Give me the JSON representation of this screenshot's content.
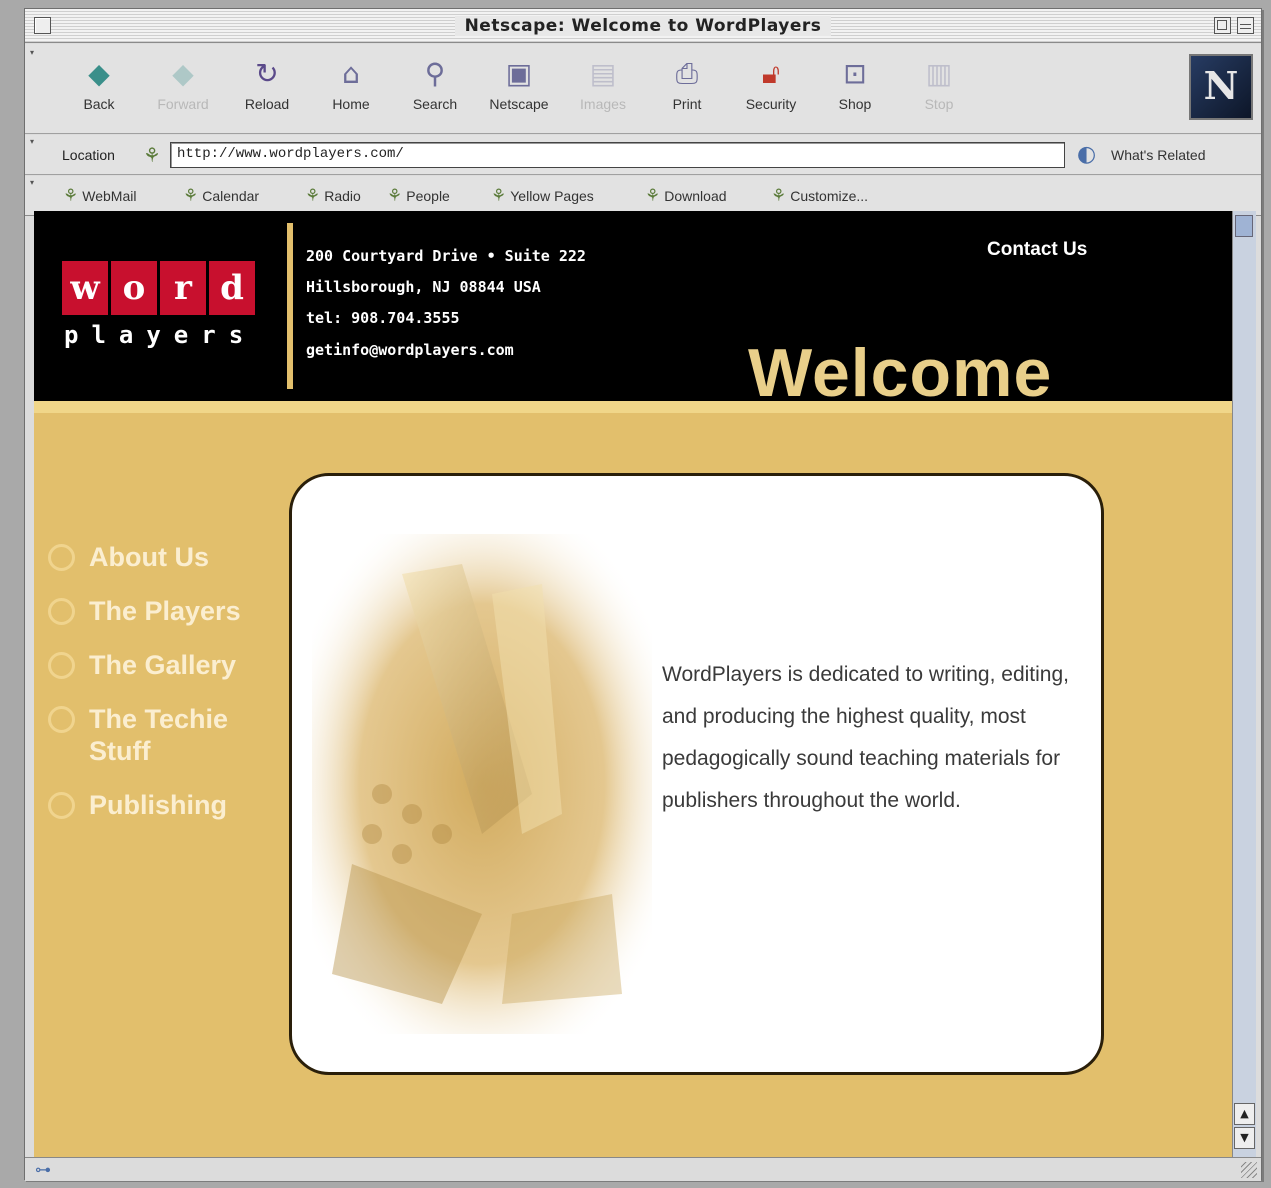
{
  "window": {
    "title": "Netscape: Welcome to WordPlayers"
  },
  "toolbar": {
    "buttons": [
      {
        "label": "Back",
        "icon": "back-arrow-icon"
      },
      {
        "label": "Forward",
        "icon": "forward-arrow-icon"
      },
      {
        "label": "Reload",
        "icon": "reload-icon"
      },
      {
        "label": "Home",
        "icon": "home-icon"
      },
      {
        "label": "Search",
        "icon": "search-icon"
      },
      {
        "label": "Netscape",
        "icon": "netscape-icon"
      },
      {
        "label": "Images",
        "icon": "images-icon"
      },
      {
        "label": "Print",
        "icon": "print-icon"
      },
      {
        "label": "Security",
        "icon": "lock-icon"
      },
      {
        "label": "Shop",
        "icon": "shop-icon"
      },
      {
        "label": "Stop",
        "icon": "stop-icon"
      }
    ],
    "brand_letter": "N"
  },
  "location_bar": {
    "label": "Location",
    "url": "http://www.wordplayers.com/",
    "related_label": "What's Related"
  },
  "personal_toolbar": {
    "items": [
      "WebMail",
      "Calendar",
      "Radio",
      "People",
      "Yellow Pages",
      "Download",
      "Customize..."
    ]
  },
  "site": {
    "logo_word": [
      "w",
      "o",
      "r",
      "d"
    ],
    "logo_players": "players",
    "address": [
      "200 Courtyard Drive • Suite 222",
      "Hillsborough, NJ 08844 USA",
      "tel: 908.704.3555",
      "getinfo@wordplayers.com"
    ],
    "contact_link": "Contact Us",
    "welcome": "Welcome",
    "nav": [
      "About Us",
      "The Players",
      "The Gallery",
      "The Techie Stuff",
      "Publishing"
    ],
    "intro": "WordPlayers is dedicated to  writing, editing, and producing the highest quality, most pedagogically sound teaching materials for publishers throughout the world."
  },
  "colors": {
    "page_background": "#e2bf6c",
    "header_background": "#000000",
    "logo_red": "#c8102e",
    "welcome_text": "#e9cf8a",
    "nav_text": "#fbeed0"
  }
}
